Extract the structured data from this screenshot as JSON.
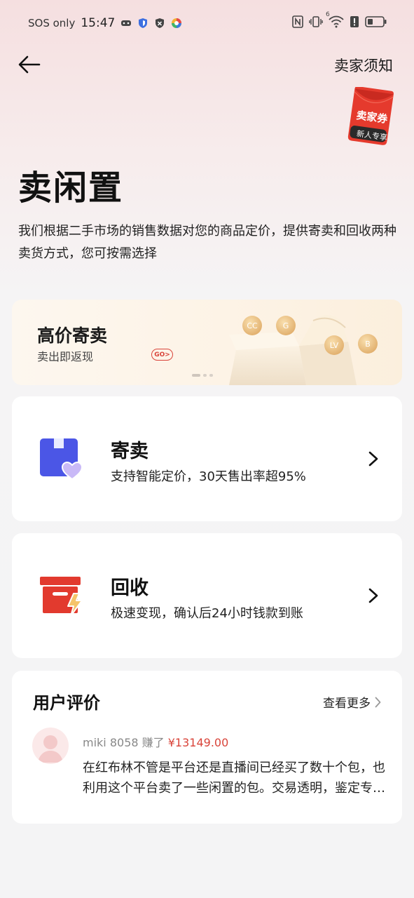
{
  "status_bar": {
    "carrier": "SOS only",
    "time": "15:47",
    "network_badge": "6"
  },
  "header": {
    "back_icon": "arrow-left-icon",
    "notice_label": "卖家须知"
  },
  "coupon": {
    "title": "卖家券",
    "subtitle": "新人专享"
  },
  "page": {
    "title": "卖闲置",
    "description": "我们根据二手市场的销售数据对您的商品定价，提供寄卖和回收两种卖货方式，您可按需选择"
  },
  "banner": {
    "title": "高价寄卖",
    "subtitle": "卖出即返现",
    "go_label": "GO>",
    "slide_count": 3,
    "active_slide": 1
  },
  "options": [
    {
      "title": "寄卖",
      "description": "支持智能定价，30天售出率超95%",
      "icon": "consignment-box-heart-icon",
      "color": "#4b56e6"
    },
    {
      "title": "回收",
      "description": "极速变现，确认后24小时钱款到账",
      "icon": "recycle-box-lightning-icon",
      "color": "#e23a2e"
    }
  ],
  "reviews": {
    "heading": "用户评价",
    "more_label": "查看更多",
    "items": [
      {
        "user": "miki 8058",
        "earned_label": "赚了",
        "amount": "¥13149.00",
        "text": "在红布林不管是平台还是直播间已经买了数十个包，也利用这个平台卖了一些闲置的包。交易透明，鉴定专业，体验非常好。"
      }
    ]
  },
  "colors": {
    "accent_red": "#d9443a",
    "consign_blue": "#4b56e6",
    "recycle_red": "#e23a2e"
  }
}
